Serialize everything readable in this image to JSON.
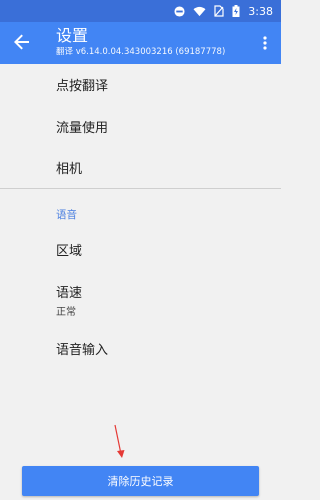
{
  "status_bar": {
    "time": "3:38"
  },
  "app_bar": {
    "title": "设置",
    "subtitle": "翻译 v6.14.0.04.343003216 (69187778)"
  },
  "settings": {
    "group1": [
      {
        "label": "点按翻译"
      },
      {
        "label": "流量使用"
      },
      {
        "label": "相机"
      }
    ],
    "section_header": "语音",
    "group2": [
      {
        "label": "区域"
      },
      {
        "label": "语速",
        "value": "正常"
      },
      {
        "label": "语音输入"
      }
    ]
  },
  "bottom_button": {
    "label": "清除历史记录"
  },
  "colors": {
    "accent": "#4285f4",
    "status_bar": "#3a6fd8",
    "annotation_arrow": "#e53935"
  }
}
